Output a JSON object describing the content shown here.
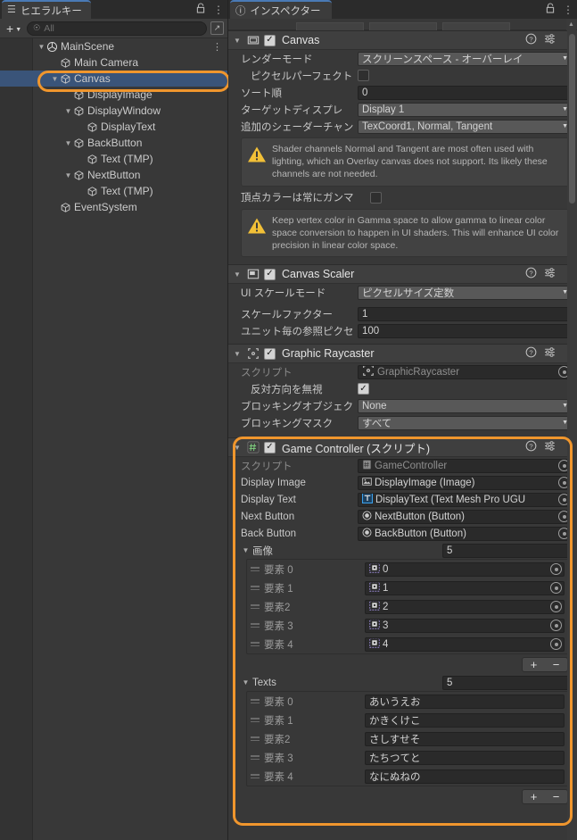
{
  "hierarchy": {
    "tab_label": "ヒエラルキー",
    "tab_icon": "hierarchy-icon",
    "lock_icon": "lock-icon",
    "menu_icon": "kebab-menu-icon",
    "add_label": "+",
    "search_placeholder": "All",
    "items": [
      {
        "label": "MainScene",
        "depth": 0,
        "arrow": "▼",
        "icon": "unity-scene-icon",
        "selected": false,
        "menu": "⋮"
      },
      {
        "label": "Main Camera",
        "depth": 1,
        "arrow": "",
        "icon": "gameobject-icon",
        "selected": false
      },
      {
        "label": "Canvas",
        "depth": 1,
        "arrow": "▼",
        "icon": "gameobject-icon",
        "selected": true
      },
      {
        "label": "DisplayImage",
        "depth": 2,
        "arrow": "",
        "icon": "gameobject-icon",
        "selected": false
      },
      {
        "label": "DisplayWindow",
        "depth": 2,
        "arrow": "▼",
        "icon": "gameobject-icon",
        "selected": false
      },
      {
        "label": "DisplayText",
        "depth": 3,
        "arrow": "",
        "icon": "gameobject-icon",
        "selected": false
      },
      {
        "label": "BackButton",
        "depth": 2,
        "arrow": "▼",
        "icon": "gameobject-icon",
        "selected": false
      },
      {
        "label": "Text (TMP)",
        "depth": 3,
        "arrow": "",
        "icon": "gameobject-icon",
        "selected": false
      },
      {
        "label": "NextButton",
        "depth": 2,
        "arrow": "▼",
        "icon": "gameobject-icon",
        "selected": false
      },
      {
        "label": "Text (TMP)",
        "depth": 3,
        "arrow": "",
        "icon": "gameobject-icon",
        "selected": false
      },
      {
        "label": "EventSystem",
        "depth": 1,
        "arrow": "",
        "icon": "gameobject-icon",
        "selected": false
      }
    ]
  },
  "inspector": {
    "tab_label": "インスペクター",
    "tab_icon": "info-icon",
    "lock_icon": "lock-icon",
    "menu_icon": "kebab-menu-icon",
    "canvas": {
      "title": "Canvas",
      "enabled": true,
      "render_mode": {
        "label": "レンダーモード",
        "value": "スクリーンスペース - オーバーレイ"
      },
      "pixel_perfect": {
        "label": "ピクセルパーフェクト",
        "value": false
      },
      "sort_order": {
        "label": "ソート順",
        "value": "0"
      },
      "target_display": {
        "label": "ターゲットディスプレ",
        "value": "Display 1"
      },
      "additional_shader": {
        "label": "追加のシェーダーチャン",
        "value": "TexCoord1, Normal, Tangent"
      },
      "warning1": "Shader channels Normal and Tangent are most often used with lighting, which an Overlay canvas does not support. Its likely these channels are not needed.",
      "vertex_color": {
        "label": "頂点カラーは常にガンマ",
        "value": false
      },
      "warning2": "Keep vertex color in Gamma space to allow gamma to linear color space conversion to happen in UI shaders. This will enhance UI color precision in linear color space."
    },
    "canvas_scaler": {
      "title": "Canvas Scaler",
      "enabled": true,
      "ui_scale_mode": {
        "label": "UI スケールモード",
        "value": "ピクセルサイズ定数"
      },
      "scale_factor": {
        "label": "スケールファクター",
        "value": "1"
      },
      "ref_pixels": {
        "label": "ユニット毎の参照ピクセ",
        "value": "100"
      }
    },
    "graphic_raycaster": {
      "title": "Graphic Raycaster",
      "enabled": true,
      "script": {
        "label": "スクリプト",
        "value": "GraphicRaycaster"
      },
      "ignore_reversed": {
        "label": "反対方向を無視",
        "value": true
      },
      "blocking_objects": {
        "label": "ブロッキングオブジェク",
        "value": "None"
      },
      "blocking_mask": {
        "label": "ブロッキングマスク",
        "value": "すべて"
      }
    },
    "game_controller": {
      "title": "Game Controller (スクリプト)",
      "enabled": true,
      "script": {
        "label": "スクリプト",
        "value": "GameController"
      },
      "fields": [
        {
          "label": "Display Image",
          "value": "DisplayImage (Image)",
          "icon": "image-component-icon"
        },
        {
          "label": "Display Text",
          "value": "DisplayText (Text Mesh Pro UGU",
          "icon": "tmp-text-icon"
        },
        {
          "label": "Next Button",
          "value": "NextButton (Button)",
          "icon": "button-component-icon"
        },
        {
          "label": "Back Button",
          "value": "BackButton (Button)",
          "icon": "button-component-icon"
        }
      ],
      "images_array": {
        "label": "画像",
        "count": "5",
        "elements": [
          {
            "label": "要素 0",
            "value": "0",
            "icon": "sprite-icon"
          },
          {
            "label": "要素 1",
            "value": "1",
            "icon": "sprite-icon"
          },
          {
            "label": "要素2",
            "value": "2",
            "icon": "sprite-icon"
          },
          {
            "label": "要素 3",
            "value": "3",
            "icon": "sprite-icon"
          },
          {
            "label": "要素 4",
            "value": "4",
            "icon": "sprite-icon"
          }
        ],
        "add_label": "+",
        "remove_label": "−"
      },
      "texts_array": {
        "label": "Texts",
        "count": "5",
        "elements": [
          {
            "label": "要素 0",
            "value": "あいうえお"
          },
          {
            "label": "要素 1",
            "value": "かきくけこ"
          },
          {
            "label": "要素2",
            "value": "さしすせそ"
          },
          {
            "label": "要素 3",
            "value": "たちつてと"
          },
          {
            "label": "要素 4",
            "value": "なにぬねの"
          }
        ],
        "add_label": "+",
        "remove_label": "−"
      }
    }
  },
  "colors": {
    "highlight_ring": "#f0962d",
    "selection": "#3a5479",
    "panel_bg": "#383838",
    "warning": "#f2c037"
  }
}
